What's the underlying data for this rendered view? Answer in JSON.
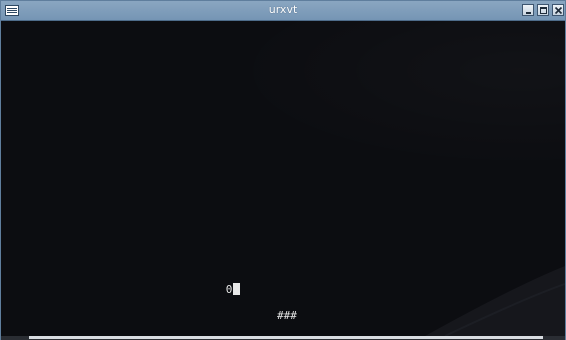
{
  "window": {
    "title": "urxvt"
  },
  "titlebar_buttons": {
    "minimize_icon": "minimize-icon",
    "maximize_icon": "maximize-icon",
    "close_icon": "close-icon"
  },
  "terminal": {
    "line_text": "0",
    "bottom_text": "###"
  },
  "colors": {
    "titlebar": "#7f9dbb",
    "background": "#0c0d11",
    "text": "#e6e6e6"
  }
}
